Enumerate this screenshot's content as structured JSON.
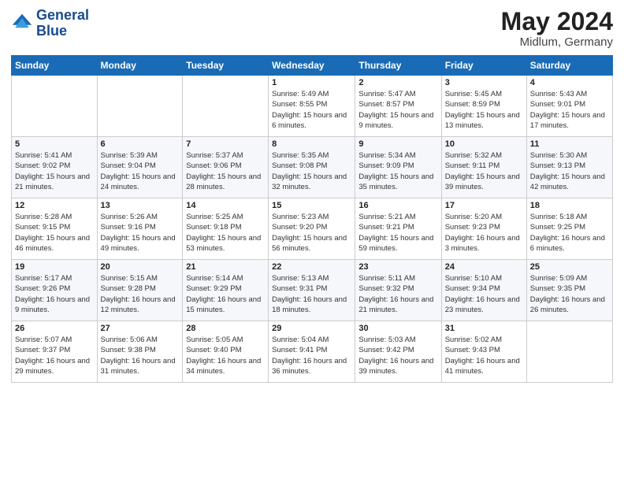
{
  "header": {
    "logo_line1": "General",
    "logo_line2": "Blue",
    "month_title": "May 2024",
    "location": "Midlum, Germany"
  },
  "weekdays": [
    "Sunday",
    "Monday",
    "Tuesday",
    "Wednesday",
    "Thursday",
    "Friday",
    "Saturday"
  ],
  "rows": [
    [
      {
        "day": "",
        "info": ""
      },
      {
        "day": "",
        "info": ""
      },
      {
        "day": "",
        "info": ""
      },
      {
        "day": "1",
        "info": "Sunrise: 5:49 AM\nSunset: 8:55 PM\nDaylight: 15 hours\nand 6 minutes."
      },
      {
        "day": "2",
        "info": "Sunrise: 5:47 AM\nSunset: 8:57 PM\nDaylight: 15 hours\nand 9 minutes."
      },
      {
        "day": "3",
        "info": "Sunrise: 5:45 AM\nSunset: 8:59 PM\nDaylight: 15 hours\nand 13 minutes."
      },
      {
        "day": "4",
        "info": "Sunrise: 5:43 AM\nSunset: 9:01 PM\nDaylight: 15 hours\nand 17 minutes."
      }
    ],
    [
      {
        "day": "5",
        "info": "Sunrise: 5:41 AM\nSunset: 9:02 PM\nDaylight: 15 hours\nand 21 minutes."
      },
      {
        "day": "6",
        "info": "Sunrise: 5:39 AM\nSunset: 9:04 PM\nDaylight: 15 hours\nand 24 minutes."
      },
      {
        "day": "7",
        "info": "Sunrise: 5:37 AM\nSunset: 9:06 PM\nDaylight: 15 hours\nand 28 minutes."
      },
      {
        "day": "8",
        "info": "Sunrise: 5:35 AM\nSunset: 9:08 PM\nDaylight: 15 hours\nand 32 minutes."
      },
      {
        "day": "9",
        "info": "Sunrise: 5:34 AM\nSunset: 9:09 PM\nDaylight: 15 hours\nand 35 minutes."
      },
      {
        "day": "10",
        "info": "Sunrise: 5:32 AM\nSunset: 9:11 PM\nDaylight: 15 hours\nand 39 minutes."
      },
      {
        "day": "11",
        "info": "Sunrise: 5:30 AM\nSunset: 9:13 PM\nDaylight: 15 hours\nand 42 minutes."
      }
    ],
    [
      {
        "day": "12",
        "info": "Sunrise: 5:28 AM\nSunset: 9:15 PM\nDaylight: 15 hours\nand 46 minutes."
      },
      {
        "day": "13",
        "info": "Sunrise: 5:26 AM\nSunset: 9:16 PM\nDaylight: 15 hours\nand 49 minutes."
      },
      {
        "day": "14",
        "info": "Sunrise: 5:25 AM\nSunset: 9:18 PM\nDaylight: 15 hours\nand 53 minutes."
      },
      {
        "day": "15",
        "info": "Sunrise: 5:23 AM\nSunset: 9:20 PM\nDaylight: 15 hours\nand 56 minutes."
      },
      {
        "day": "16",
        "info": "Sunrise: 5:21 AM\nSunset: 9:21 PM\nDaylight: 15 hours\nand 59 minutes."
      },
      {
        "day": "17",
        "info": "Sunrise: 5:20 AM\nSunset: 9:23 PM\nDaylight: 16 hours\nand 3 minutes."
      },
      {
        "day": "18",
        "info": "Sunrise: 5:18 AM\nSunset: 9:25 PM\nDaylight: 16 hours\nand 6 minutes."
      }
    ],
    [
      {
        "day": "19",
        "info": "Sunrise: 5:17 AM\nSunset: 9:26 PM\nDaylight: 16 hours\nand 9 minutes."
      },
      {
        "day": "20",
        "info": "Sunrise: 5:15 AM\nSunset: 9:28 PM\nDaylight: 16 hours\nand 12 minutes."
      },
      {
        "day": "21",
        "info": "Sunrise: 5:14 AM\nSunset: 9:29 PM\nDaylight: 16 hours\nand 15 minutes."
      },
      {
        "day": "22",
        "info": "Sunrise: 5:13 AM\nSunset: 9:31 PM\nDaylight: 16 hours\nand 18 minutes."
      },
      {
        "day": "23",
        "info": "Sunrise: 5:11 AM\nSunset: 9:32 PM\nDaylight: 16 hours\nand 21 minutes."
      },
      {
        "day": "24",
        "info": "Sunrise: 5:10 AM\nSunset: 9:34 PM\nDaylight: 16 hours\nand 23 minutes."
      },
      {
        "day": "25",
        "info": "Sunrise: 5:09 AM\nSunset: 9:35 PM\nDaylight: 16 hours\nand 26 minutes."
      }
    ],
    [
      {
        "day": "26",
        "info": "Sunrise: 5:07 AM\nSunset: 9:37 PM\nDaylight: 16 hours\nand 29 minutes."
      },
      {
        "day": "27",
        "info": "Sunrise: 5:06 AM\nSunset: 9:38 PM\nDaylight: 16 hours\nand 31 minutes."
      },
      {
        "day": "28",
        "info": "Sunrise: 5:05 AM\nSunset: 9:40 PM\nDaylight: 16 hours\nand 34 minutes."
      },
      {
        "day": "29",
        "info": "Sunrise: 5:04 AM\nSunset: 9:41 PM\nDaylight: 16 hours\nand 36 minutes."
      },
      {
        "day": "30",
        "info": "Sunrise: 5:03 AM\nSunset: 9:42 PM\nDaylight: 16 hours\nand 39 minutes."
      },
      {
        "day": "31",
        "info": "Sunrise: 5:02 AM\nSunset: 9:43 PM\nDaylight: 16 hours\nand 41 minutes."
      },
      {
        "day": "",
        "info": ""
      }
    ]
  ]
}
